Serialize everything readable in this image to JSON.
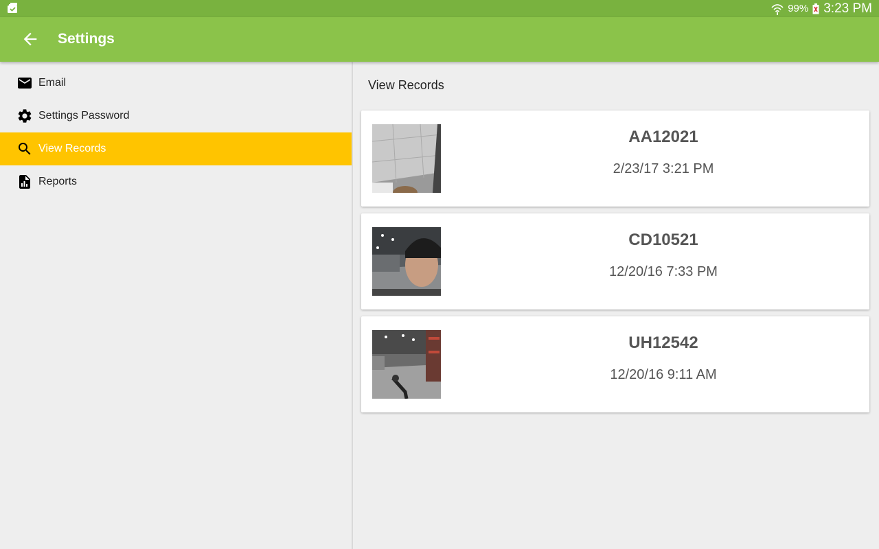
{
  "status_bar": {
    "battery_percent": "99%",
    "time": "3:23 PM"
  },
  "app_bar": {
    "title": "Settings",
    "back_icon": "arrow-back-icon"
  },
  "sidebar": {
    "items": [
      {
        "label": "Email",
        "icon": "mail-icon",
        "active": false
      },
      {
        "label": "Settings Password",
        "icon": "gear-icon",
        "active": false
      },
      {
        "label": "View Records",
        "icon": "search-icon",
        "active": true
      },
      {
        "label": "Reports",
        "icon": "report-doc-icon",
        "active": false
      }
    ]
  },
  "main": {
    "section_title": "View Records",
    "records": [
      {
        "id": "AA12021",
        "date": "2/23/17 3:21 PM"
      },
      {
        "id": "CD10521",
        "date": "12/20/16 7:33 PM"
      },
      {
        "id": "UH12542",
        "date": "12/20/16 9:11 AM"
      }
    ]
  },
  "colors": {
    "status_bar": "#79b23f",
    "app_bar": "#8bc34a",
    "active_item": "#ffc400",
    "background": "#eeeeee"
  }
}
